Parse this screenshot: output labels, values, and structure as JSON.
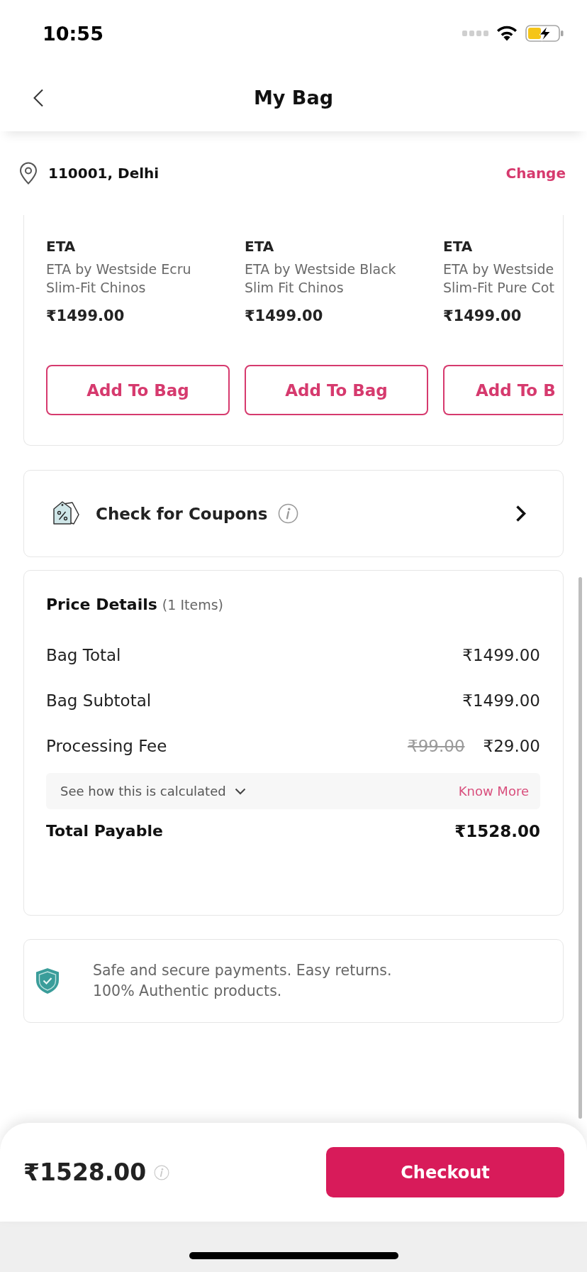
{
  "status_bar": {
    "time": "10:55"
  },
  "header": {
    "title": "My Bag"
  },
  "location": {
    "address": "110001, Delhi",
    "action": "Change"
  },
  "products": [
    {
      "brand": "ETA",
      "name": "ETA by Westside Ecru Slim-Fit Chinos",
      "price": "₹1499.00",
      "button": "Add To Bag"
    },
    {
      "brand": "ETA",
      "name": "ETA by Westside Black Slim Fit Chinos",
      "price": "₹1499.00",
      "button": "Add To Bag"
    },
    {
      "brand": "ETA",
      "name": "ETA by Westside Slim-Fit Pure Cot",
      "price": "₹1499.00",
      "button": "Add To B"
    }
  ],
  "coupons": {
    "label": "Check for Coupons"
  },
  "price_details": {
    "title": "Price Details",
    "count": "(1 Items)",
    "rows": [
      {
        "label": "Bag Total",
        "value": "₹1499.00"
      },
      {
        "label": "Bag Subtotal",
        "value": "₹1499.00"
      },
      {
        "label": "Processing Fee",
        "original_value": "₹99.00",
        "value": "₹29.00"
      }
    ],
    "calculation": {
      "label": "See how this is calculated",
      "expanded": false,
      "link": "Know More"
    },
    "total": {
      "label": "Total Payable",
      "value": "₹1528.00"
    }
  },
  "trust_note": {
    "text": "Safe and secure payments. Easy returns. 100% Authentic products."
  },
  "checkout_bar": {
    "total": "₹1528.00",
    "button": "Checkout"
  }
}
